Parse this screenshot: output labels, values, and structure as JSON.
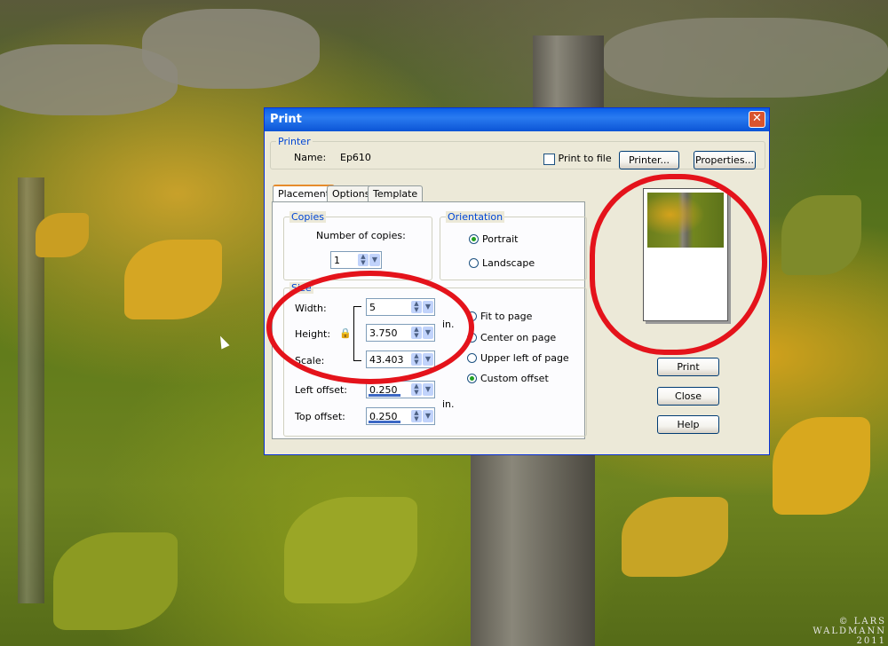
{
  "dialog": {
    "title": "Print",
    "close_glyph": "✕",
    "printer_group": {
      "legend": "Printer",
      "name_label": "Name:",
      "name_value": "Ep610",
      "print_to_file_label": "Print to file",
      "print_to_file_checked": false,
      "printer_button": "Printer...",
      "properties_button": "Properties..."
    },
    "tabs": [
      {
        "label": "Placement",
        "active": true
      },
      {
        "label": "Options",
        "active": false
      },
      {
        "label": "Template",
        "active": false
      }
    ],
    "copies_group": {
      "legend": "Copies",
      "number_label": "Number of copies:",
      "value": "1"
    },
    "orientation_group": {
      "legend": "Orientation",
      "options": [
        {
          "label": "Portrait",
          "selected": true
        },
        {
          "label": "Landscape",
          "selected": false
        }
      ]
    },
    "size_group": {
      "legend": "Size",
      "width_label": "Width:",
      "width_value": "5",
      "height_label": "Height:",
      "height_value": "3.750",
      "scale_label": "Scale:",
      "scale_value": "43.403",
      "left_offset_label": "Left offset:",
      "left_offset_value": "0.250",
      "top_offset_label": "Top offset:",
      "top_offset_value": "0.250",
      "unit_top": "in.",
      "unit_bottom": "in.",
      "position_options": [
        {
          "label": "Fit to page",
          "selected": false
        },
        {
          "label": "Center on page",
          "selected": false
        },
        {
          "label": "Upper left of page",
          "selected": false
        },
        {
          "label": "Custom offset",
          "selected": true
        }
      ]
    },
    "buttons": {
      "print": "Print",
      "close": "Close",
      "help": "Help"
    }
  },
  "watermark": {
    "line1": "© LARS",
    "line2": "WALDMANN",
    "line3": "2011"
  },
  "colors": {
    "annotation_red": "#e4131b",
    "titlebar_blue": "#0a5fe8"
  }
}
